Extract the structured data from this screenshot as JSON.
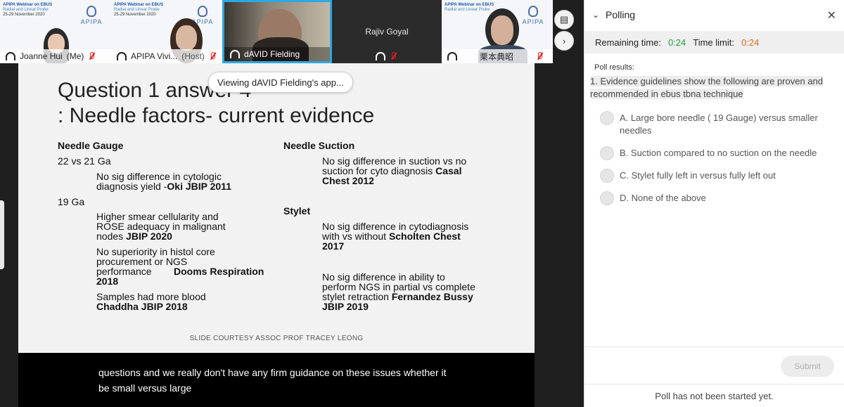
{
  "video_strip": {
    "tiles": [
      {
        "name": "Joanne Hui",
        "suffix": "(Me)",
        "slide_title": "APIPA Webinar on EBUS",
        "slide_sub": "Radial and Linear Probe",
        "slide_date": "25-29 November 2020"
      },
      {
        "name": "APIPA Vivi...",
        "suffix": "(Host)",
        "slide_title": "APIPA Webinar on EBUS",
        "slide_sub": "Radial and Linear Probe",
        "slide_date": "25-29 November 2020"
      },
      {
        "name": "dAVID Fielding",
        "suffix": ""
      },
      {
        "name": "Rajiv Goyal",
        "suffix": ""
      },
      {
        "name": "栗本典昭",
        "suffix": "",
        "slide_title": "APIPA Webinar on EBUS",
        "slide_sub": "Radial and Linear Probe"
      }
    ],
    "logo_text": "APIPA"
  },
  "viewing_banner": "Viewing dAVID Fielding's app...",
  "slide": {
    "title_line1": "Question 1 answer 4",
    "title_line2": ": Needle factors- current evidence",
    "left_heading": "Needle Gauge",
    "gauge_22": "22 vs 21 Ga",
    "oki_l1": "No sig difference in cytologic",
    "oki_l2a": "diagnosis yield -",
    "oki_l2b": "Oki JBIP 2011",
    "gauge_19": "19 Ga",
    "smear_l1": "Higher smear cellularity and",
    "smear_l2": "ROSE adequacy in malignant",
    "smear_l3a": "nodes ",
    "smear_l3b": "JBIP 2020",
    "core_l1": "No superiority in histol core",
    "core_l2": "procurement or NGS",
    "core_l3a": "performance",
    "core_l3b": "Dooms Respiration",
    "core_l4": "2018",
    "blood_l1": "Samples had more blood",
    "blood_l2": "Chaddha JBIP 2018",
    "right_heading1": "Needle Suction",
    "suction_l1": "No sig difference in suction vs no",
    "suction_l2a": "suction for cyto diagnosis  ",
    "suction_l2b": "Casal",
    "suction_l3": "Chest 2012",
    "right_heading2": "Stylet",
    "stylet_l1": "No sig difference in cytodiagnosis",
    "stylet_l2a": "with vs without ",
    "stylet_l2b": "Scholten Chest",
    "stylet_l3": "2017",
    "ngs_l1": "No sig difference in ability to",
    "ngs_l2": "perform NGS in partial vs complete",
    "ngs_l3a": "stylet retraction ",
    "ngs_l3b": "Fernandez Bussy",
    "ngs_l4": "JBIP 2019",
    "credit": "SLIDE COURTESY ASSOC PROF TRACEY LEONG"
  },
  "captions": {
    "line1": "questions and we really don't have any firm guidance on these issues whether it",
    "line2": "be small versus large"
  },
  "poll": {
    "title": "Polling",
    "remaining_label": "Remaining time:",
    "remaining_value": "0:24",
    "limit_label": "Time limit:",
    "limit_value": "0:24",
    "results_label": "Poll results:",
    "question": "1.  Evidence guidelines show the following are proven and recommended  in ebus tbna technique",
    "options": [
      "A.  Large bore needle ( 19 Gauge) versus smaller needles",
      "B.  Suction compared to no suction on the needle",
      "C.  Stylet fully left in versus fully left out",
      "D.  None of the above"
    ],
    "submit_label": "Submit",
    "status": "Poll has not been started yet."
  },
  "colors": {
    "accent_blue": "#2ea8e0",
    "time_green": "#1e9e3e",
    "time_orange": "#e06a1a"
  }
}
